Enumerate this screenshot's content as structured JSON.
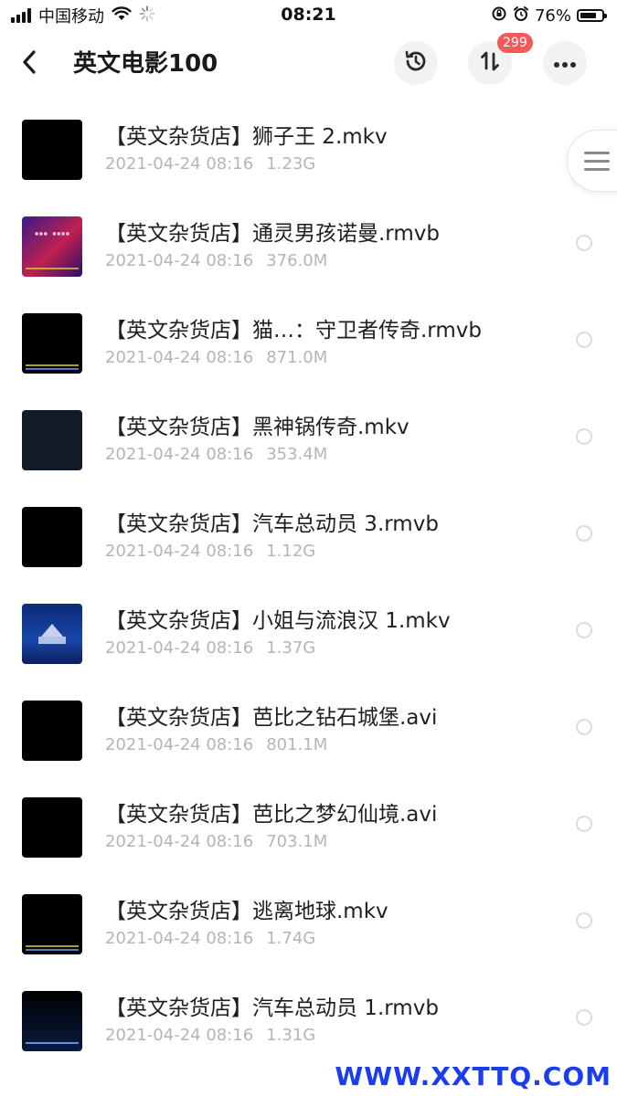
{
  "status_bar": {
    "carrier": "中国移动",
    "time": "08:21",
    "battery_percent": "76%",
    "battery_level": 0.76
  },
  "header": {
    "title": "英文电影100",
    "transfer_badge": "299",
    "icons": {
      "back": "chevron-left-icon",
      "history": "history-icon",
      "transfer": "transfer-icon",
      "more": "more-icon"
    }
  },
  "files": [
    {
      "name": "【英文杂货店】狮子王 2.mkv",
      "date": "2021-04-24 08:16",
      "size": "1.23G",
      "thumb": "black"
    },
    {
      "name": "【英文杂货店】通灵男孩诺曼.rmvb",
      "date": "2021-04-24 08:16",
      "size": "376.0M",
      "thumb": "purple"
    },
    {
      "name": "【英文杂货店】猫…：守卫者传奇.rmvb",
      "date": "2021-04-24 08:16",
      "size": "871.0M",
      "thumb": "black-subtitles"
    },
    {
      "name": "【英文杂货店】黑神锅传奇.mkv",
      "date": "2021-04-24 08:16",
      "size": "353.4M",
      "thumb": "navy"
    },
    {
      "name": "【英文杂货店】汽车总动员 3.rmvb",
      "date": "2021-04-24 08:16",
      "size": "1.12G",
      "thumb": "black"
    },
    {
      "name": "【英文杂货店】小姐与流浪汉 1.mkv",
      "date": "2021-04-24 08:16",
      "size": "1.37G",
      "thumb": "disney"
    },
    {
      "name": "【英文杂货店】芭比之钻石城堡.avi",
      "date": "2021-04-24 08:16",
      "size": "801.1M",
      "thumb": "black"
    },
    {
      "name": "【英文杂货店】芭比之梦幻仙境.avi",
      "date": "2021-04-24 08:16",
      "size": "703.1M",
      "thumb": "black"
    },
    {
      "name": "【英文杂货店】逃离地球.mkv",
      "date": "2021-04-24 08:16",
      "size": "1.74G",
      "thumb": "black-subtitles"
    },
    {
      "name": "【英文杂货店】汽车总动员 1.rmvb",
      "date": "2021-04-24 08:16",
      "size": "1.31G",
      "thumb": "bluebar"
    }
  ],
  "watermark": "WWW.XXTTQ.COM"
}
